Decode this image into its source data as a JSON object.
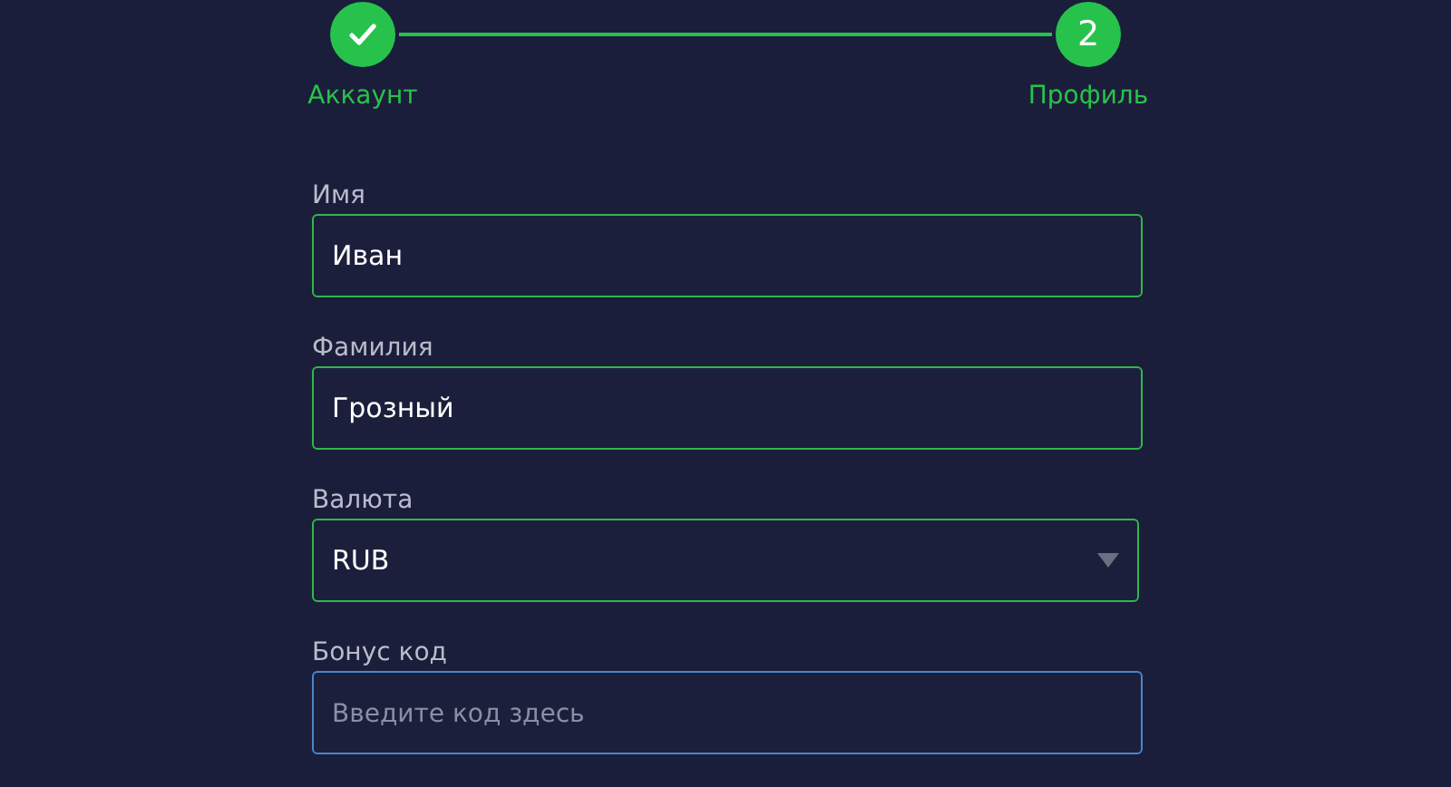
{
  "steps": [
    {
      "label": "Аккаунт",
      "completed": true
    },
    {
      "label": "Профиль",
      "completed": false,
      "number": "2"
    }
  ],
  "fields": [
    {
      "label": "Имя",
      "kind": "text",
      "value": "Иван",
      "focused": false
    },
    {
      "label": "Фамилия",
      "kind": "text",
      "value": "Грозный",
      "focused": false
    },
    {
      "label": "Валюта",
      "kind": "select",
      "value": "RUB",
      "focused": false
    },
    {
      "label": "Бонус код",
      "kind": "text",
      "placeholder": "Введите код здесь",
      "focused": true
    }
  ]
}
